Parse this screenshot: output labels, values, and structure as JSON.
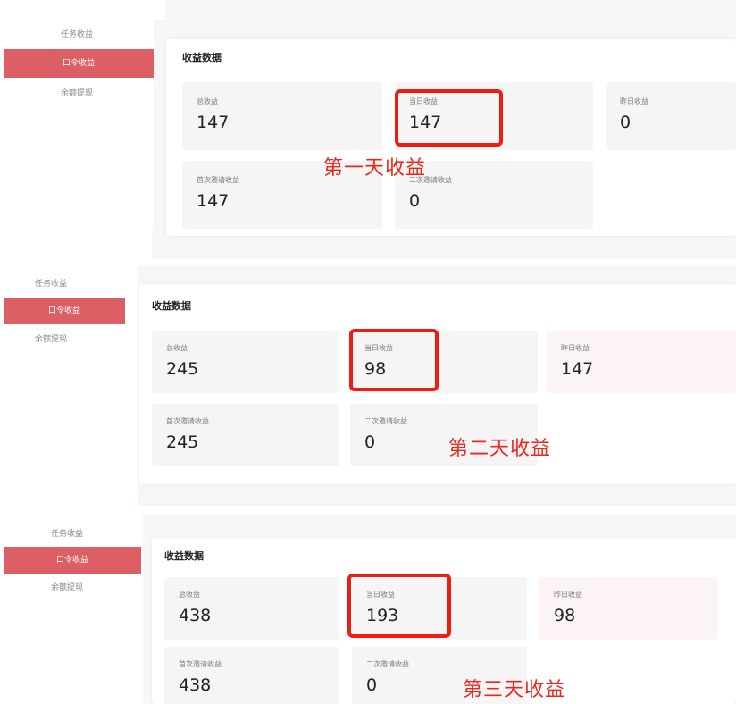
{
  "panels": [
    {
      "sidebar": [
        "任务收益",
        "口令收益",
        "余额提现"
      ],
      "section_title": "收益数据",
      "cards": [
        {
          "label": "总收益",
          "value": "147"
        },
        {
          "label": "当日收益",
          "value": "147"
        },
        {
          "label": "昨日收益",
          "value": "0"
        },
        {
          "label": "首次邀请收益",
          "value": "147"
        },
        {
          "label": "二次邀请收益",
          "value": "0"
        }
      ],
      "annotation": "第一天收益"
    },
    {
      "sidebar": [
        "任务收益",
        "口令收益",
        "余额提现"
      ],
      "section_title": "收益数据",
      "cards": [
        {
          "label": "总收益",
          "value": "245"
        },
        {
          "label": "当日收益",
          "value": "98"
        },
        {
          "label": "昨日收益",
          "value": "147"
        },
        {
          "label": "首次邀请收益",
          "value": "245"
        },
        {
          "label": "二次邀请收益",
          "value": "0"
        }
      ],
      "annotation": "第二天收益"
    },
    {
      "sidebar": [
        "任务收益",
        "口令收益",
        "余额提现"
      ],
      "section_title": "收益数据",
      "cards": [
        {
          "label": "总收益",
          "value": "438"
        },
        {
          "label": "当日收益",
          "value": "193"
        },
        {
          "label": "昨日收益",
          "value": "98"
        },
        {
          "label": "首次邀请收益",
          "value": "438"
        },
        {
          "label": "二次邀请收益",
          "value": "0"
        }
      ],
      "annotation": "第三天收益"
    }
  ],
  "colors": {
    "active_sidebar": "#dd5f66",
    "highlight_border": "#ee1d11",
    "annotation_text": "#f02418"
  }
}
